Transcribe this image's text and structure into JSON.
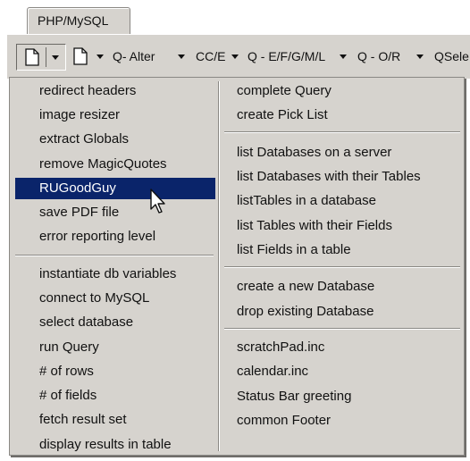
{
  "tab": {
    "label": "PHP/MySQL"
  },
  "toolbar": {
    "items": [
      {
        "label": "Q- Alter"
      },
      {
        "label": "CC/E"
      },
      {
        "label": "Q - E/F/G/M/L"
      },
      {
        "label": "Q - O/R"
      },
      {
        "label": "QSele"
      }
    ],
    "icons": [
      "new-page-icon",
      "dropdown-arrow-icon"
    ]
  },
  "menu": {
    "left": {
      "group1": [
        "redirect headers",
        "image resizer",
        "extract Globals",
        "remove MagicQuotes",
        "RUGoodGuy",
        "save PDF file",
        "error reporting level"
      ],
      "group2": [
        "instantiate db variables",
        "connect to MySQL",
        "select database",
        "run Query",
        "# of rows",
        "# of fields",
        "fetch result set",
        "display results in table"
      ]
    },
    "right": {
      "group1": [
        "complete Query",
        "create Pick List"
      ],
      "group2": [
        "list Databases on a server",
        "list Databases with their Tables",
        "listTables in a database",
        "list Tables with their Fields",
        "list Fields in a table"
      ],
      "group3": [
        "create a new Database",
        "drop existing Database"
      ],
      "group4": [
        "scratchPad.inc",
        "calendar.inc",
        "Status Bar greeting",
        "common Footer"
      ]
    },
    "highlighted": "RUGoodGuy"
  },
  "colors": {
    "menu_bg": "#d6d3ce",
    "highlight": "#0a246a"
  }
}
